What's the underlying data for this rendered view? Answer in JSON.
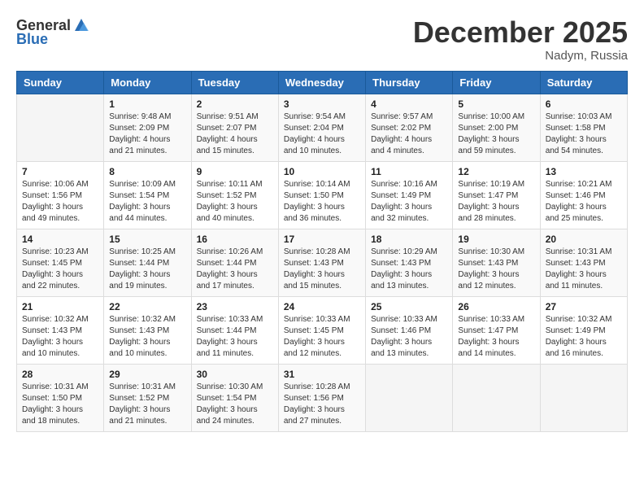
{
  "header": {
    "logo_general": "General",
    "logo_blue": "Blue",
    "title": "December 2025",
    "location": "Nadym, Russia"
  },
  "weekdays": [
    "Sunday",
    "Monday",
    "Tuesday",
    "Wednesday",
    "Thursday",
    "Friday",
    "Saturday"
  ],
  "weeks": [
    [
      {
        "day": "",
        "sunrise": "",
        "sunset": "",
        "daylight": ""
      },
      {
        "day": "1",
        "sunrise": "Sunrise: 9:48 AM",
        "sunset": "Sunset: 2:09 PM",
        "daylight": "Daylight: 4 hours and 21 minutes."
      },
      {
        "day": "2",
        "sunrise": "Sunrise: 9:51 AM",
        "sunset": "Sunset: 2:07 PM",
        "daylight": "Daylight: 4 hours and 15 minutes."
      },
      {
        "day": "3",
        "sunrise": "Sunrise: 9:54 AM",
        "sunset": "Sunset: 2:04 PM",
        "daylight": "Daylight: 4 hours and 10 minutes."
      },
      {
        "day": "4",
        "sunrise": "Sunrise: 9:57 AM",
        "sunset": "Sunset: 2:02 PM",
        "daylight": "Daylight: 4 hours and 4 minutes."
      },
      {
        "day": "5",
        "sunrise": "Sunrise: 10:00 AM",
        "sunset": "Sunset: 2:00 PM",
        "daylight": "Daylight: 3 hours and 59 minutes."
      },
      {
        "day": "6",
        "sunrise": "Sunrise: 10:03 AM",
        "sunset": "Sunset: 1:58 PM",
        "daylight": "Daylight: 3 hours and 54 minutes."
      }
    ],
    [
      {
        "day": "7",
        "sunrise": "Sunrise: 10:06 AM",
        "sunset": "Sunset: 1:56 PM",
        "daylight": "Daylight: 3 hours and 49 minutes."
      },
      {
        "day": "8",
        "sunrise": "Sunrise: 10:09 AM",
        "sunset": "Sunset: 1:54 PM",
        "daylight": "Daylight: 3 hours and 44 minutes."
      },
      {
        "day": "9",
        "sunrise": "Sunrise: 10:11 AM",
        "sunset": "Sunset: 1:52 PM",
        "daylight": "Daylight: 3 hours and 40 minutes."
      },
      {
        "day": "10",
        "sunrise": "Sunrise: 10:14 AM",
        "sunset": "Sunset: 1:50 PM",
        "daylight": "Daylight: 3 hours and 36 minutes."
      },
      {
        "day": "11",
        "sunrise": "Sunrise: 10:16 AM",
        "sunset": "Sunset: 1:49 PM",
        "daylight": "Daylight: 3 hours and 32 minutes."
      },
      {
        "day": "12",
        "sunrise": "Sunrise: 10:19 AM",
        "sunset": "Sunset: 1:47 PM",
        "daylight": "Daylight: 3 hours and 28 minutes."
      },
      {
        "day": "13",
        "sunrise": "Sunrise: 10:21 AM",
        "sunset": "Sunset: 1:46 PM",
        "daylight": "Daylight: 3 hours and 25 minutes."
      }
    ],
    [
      {
        "day": "14",
        "sunrise": "Sunrise: 10:23 AM",
        "sunset": "Sunset: 1:45 PM",
        "daylight": "Daylight: 3 hours and 22 minutes."
      },
      {
        "day": "15",
        "sunrise": "Sunrise: 10:25 AM",
        "sunset": "Sunset: 1:44 PM",
        "daylight": "Daylight: 3 hours and 19 minutes."
      },
      {
        "day": "16",
        "sunrise": "Sunrise: 10:26 AM",
        "sunset": "Sunset: 1:44 PM",
        "daylight": "Daylight: 3 hours and 17 minutes."
      },
      {
        "day": "17",
        "sunrise": "Sunrise: 10:28 AM",
        "sunset": "Sunset: 1:43 PM",
        "daylight": "Daylight: 3 hours and 15 minutes."
      },
      {
        "day": "18",
        "sunrise": "Sunrise: 10:29 AM",
        "sunset": "Sunset: 1:43 PM",
        "daylight": "Daylight: 3 hours and 13 minutes."
      },
      {
        "day": "19",
        "sunrise": "Sunrise: 10:30 AM",
        "sunset": "Sunset: 1:43 PM",
        "daylight": "Daylight: 3 hours and 12 minutes."
      },
      {
        "day": "20",
        "sunrise": "Sunrise: 10:31 AM",
        "sunset": "Sunset: 1:43 PM",
        "daylight": "Daylight: 3 hours and 11 minutes."
      }
    ],
    [
      {
        "day": "21",
        "sunrise": "Sunrise: 10:32 AM",
        "sunset": "Sunset: 1:43 PM",
        "daylight": "Daylight: 3 hours and 10 minutes."
      },
      {
        "day": "22",
        "sunrise": "Sunrise: 10:32 AM",
        "sunset": "Sunset: 1:43 PM",
        "daylight": "Daylight: 3 hours and 10 minutes."
      },
      {
        "day": "23",
        "sunrise": "Sunrise: 10:33 AM",
        "sunset": "Sunset: 1:44 PM",
        "daylight": "Daylight: 3 hours and 11 minutes."
      },
      {
        "day": "24",
        "sunrise": "Sunrise: 10:33 AM",
        "sunset": "Sunset: 1:45 PM",
        "daylight": "Daylight: 3 hours and 12 minutes."
      },
      {
        "day": "25",
        "sunrise": "Sunrise: 10:33 AM",
        "sunset": "Sunset: 1:46 PM",
        "daylight": "Daylight: 3 hours and 13 minutes."
      },
      {
        "day": "26",
        "sunrise": "Sunrise: 10:33 AM",
        "sunset": "Sunset: 1:47 PM",
        "daylight": "Daylight: 3 hours and 14 minutes."
      },
      {
        "day": "27",
        "sunrise": "Sunrise: 10:32 AM",
        "sunset": "Sunset: 1:49 PM",
        "daylight": "Daylight: 3 hours and 16 minutes."
      }
    ],
    [
      {
        "day": "28",
        "sunrise": "Sunrise: 10:31 AM",
        "sunset": "Sunset: 1:50 PM",
        "daylight": "Daylight: 3 hours and 18 minutes."
      },
      {
        "day": "29",
        "sunrise": "Sunrise: 10:31 AM",
        "sunset": "Sunset: 1:52 PM",
        "daylight": "Daylight: 3 hours and 21 minutes."
      },
      {
        "day": "30",
        "sunrise": "Sunrise: 10:30 AM",
        "sunset": "Sunset: 1:54 PM",
        "daylight": "Daylight: 3 hours and 24 minutes."
      },
      {
        "day": "31",
        "sunrise": "Sunrise: 10:28 AM",
        "sunset": "Sunset: 1:56 PM",
        "daylight": "Daylight: 3 hours and 27 minutes."
      },
      {
        "day": "",
        "sunrise": "",
        "sunset": "",
        "daylight": ""
      },
      {
        "day": "",
        "sunrise": "",
        "sunset": "",
        "daylight": ""
      },
      {
        "day": "",
        "sunrise": "",
        "sunset": "",
        "daylight": ""
      }
    ]
  ]
}
